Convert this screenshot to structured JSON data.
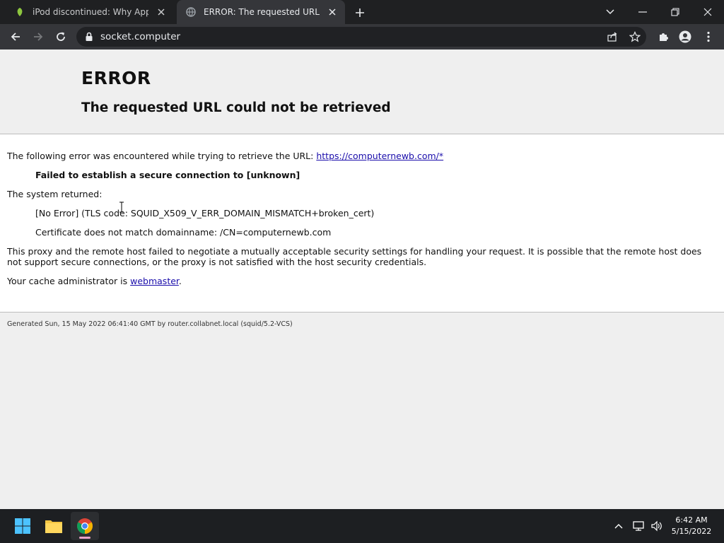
{
  "browser": {
    "tabs": [
      {
        "title": "iPod discontinued: Why Apple is",
        "active": false,
        "favicon": "green-leaf-favicon"
      },
      {
        "title": "ERROR: The requested URL could",
        "active": true,
        "favicon": "globe-icon"
      }
    ],
    "address": "socket.computer"
  },
  "page": {
    "heading": "ERROR",
    "subheading": "The requested URL could not be retrieved",
    "intro_text": "The following error was encountered while trying to retrieve the URL: ",
    "url_link": "https://computernewb.com/*",
    "failure": "Failed to establish a secure connection to [unknown]",
    "system_returned_label": "The system returned:",
    "system_error": "[No Error] (TLS code: SQUID_X509_V_ERR_DOMAIN_MISMATCH+broken_cert)",
    "certificate_msg": "Certificate does not match domainname: /CN=computernewb.com",
    "explanation": "This proxy and the remote host failed to negotiate a mutually acceptable security settings for handling your request. It is possible that the remote host does not support secure connections, or the proxy is not satisfied with the host security credentials.",
    "admin_prefix": "Your cache administrator is ",
    "admin_link": "webmaster",
    "admin_suffix": ".",
    "footer": "Generated Sun, 15 May 2022 06:41:40 GMT by router.collabnet.local (squid/5.2-VCS)"
  },
  "taskbar": {
    "time": "6:42 AM",
    "date": "5/15/2022"
  },
  "colors": {
    "titlebar": "#1f2022",
    "toolbar": "#35363a",
    "link": "#1a0dab",
    "taskbar": "#1d1f22"
  }
}
